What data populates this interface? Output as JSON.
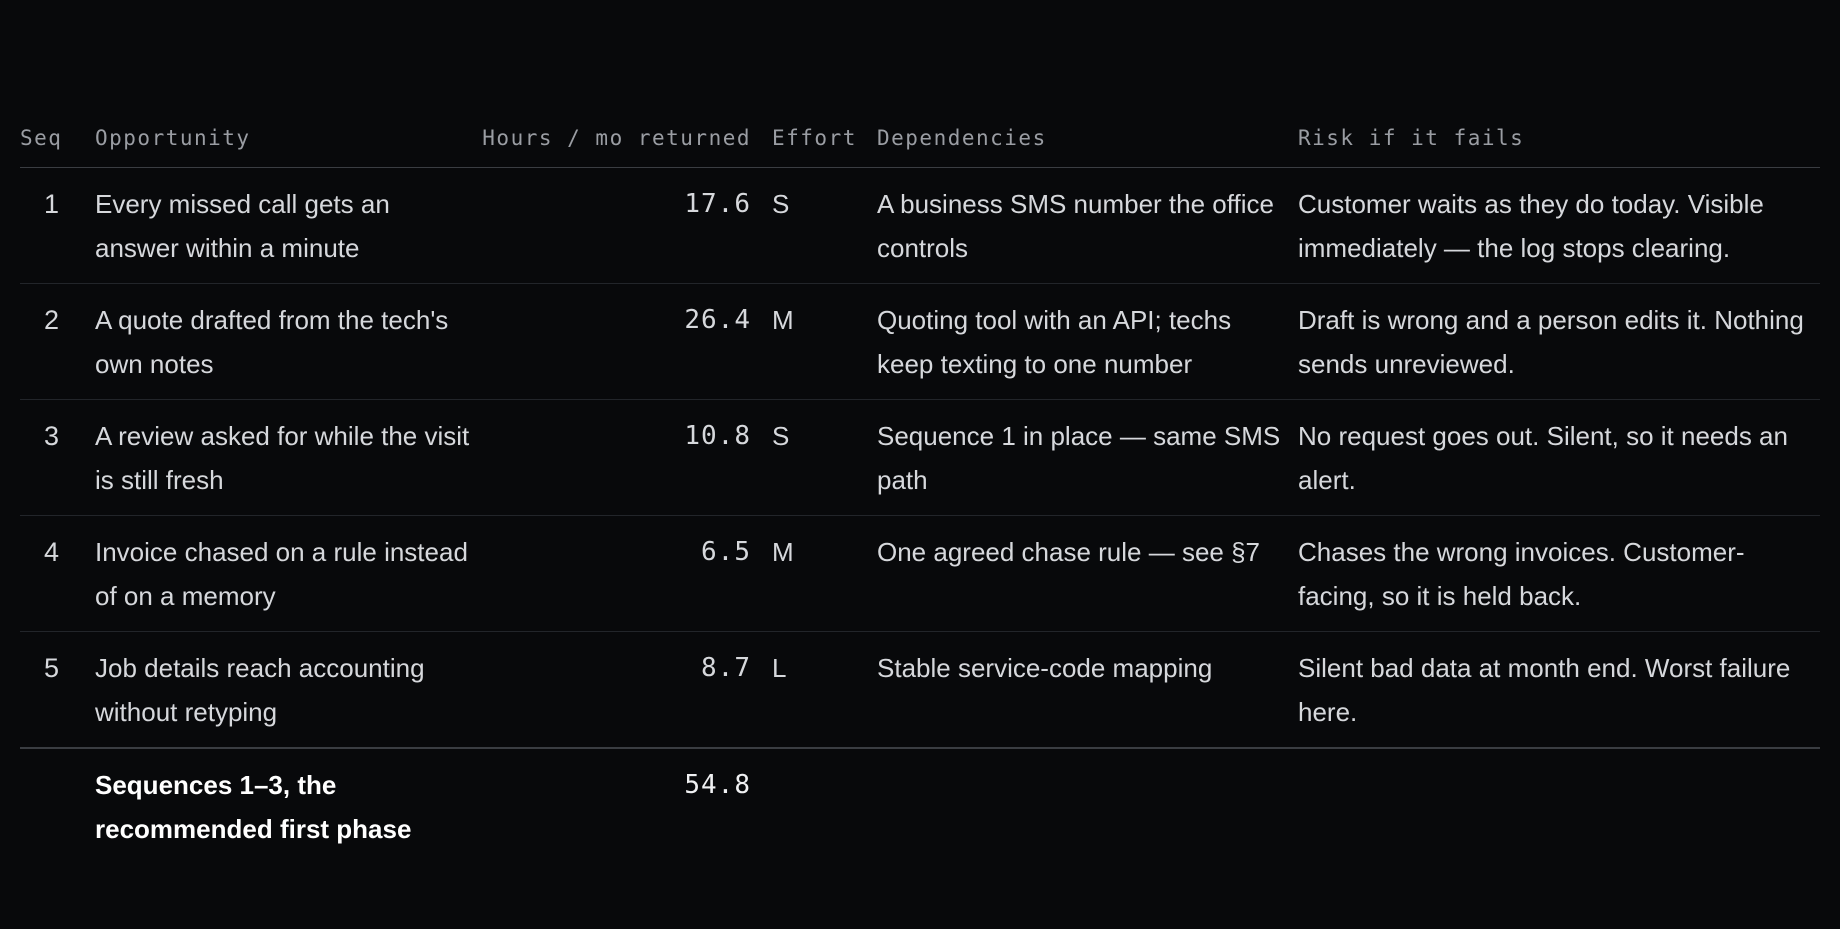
{
  "table": {
    "headers": {
      "seq": "Seq",
      "opportunity": "Opportunity",
      "hours": "Hours / mo returned",
      "effort": "Effort",
      "dependencies": "Dependencies",
      "risk": "Risk if it fails"
    },
    "rows": [
      {
        "seq": "1",
        "opportunity": "Every missed call gets an answer within a minute",
        "hours": "17.6",
        "effort": "S",
        "dependencies": "A business SMS number the office controls",
        "risk": "Customer waits as they do today. Visible immediately — the log stops clearing."
      },
      {
        "seq": "2",
        "opportunity": "A quote drafted from the tech's own notes",
        "hours": "26.4",
        "effort": "M",
        "dependencies": "Quoting tool with an API; techs keep texting to one number",
        "risk": "Draft is wrong and a person edits it. Nothing sends unreviewed."
      },
      {
        "seq": "3",
        "opportunity": "A review asked for while the visit is still fresh",
        "hours": "10.8",
        "effort": "S",
        "dependencies": "Sequence 1 in place — same SMS path",
        "risk": "No request goes out. Silent, so it needs an alert."
      },
      {
        "seq": "4",
        "opportunity": "Invoice chased on a rule instead of on a memory",
        "hours": "6.5",
        "effort": "M",
        "dependencies": "One agreed chase rule — see §7",
        "risk": "Chases the wrong invoices. Customer-facing, so it is held back."
      },
      {
        "seq": "5",
        "opportunity": "Job details reach accounting without retyping",
        "hours": "8.7",
        "effort": "L",
        "dependencies": "Stable service-code mapping",
        "risk": "Silent bad data at month end. Worst failure here."
      }
    ],
    "total": {
      "label": "Sequences 1–3, the recommended first phase",
      "hours": "54.8"
    }
  }
}
